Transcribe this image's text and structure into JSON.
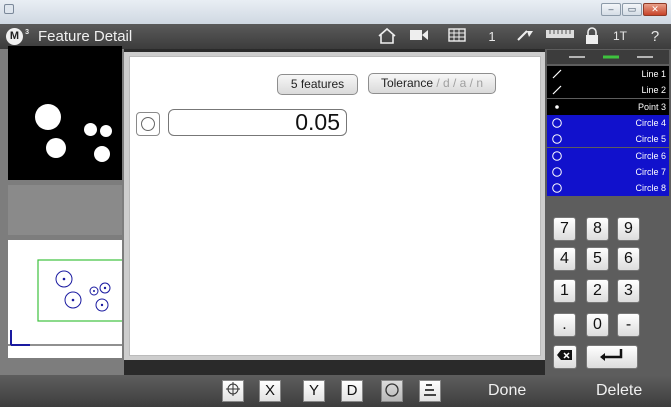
{
  "window": {
    "title": "Feature Detail",
    "logo_letter": "M",
    "logo_superscript": "3",
    "controls": [
      "–",
      "▭",
      "✕"
    ]
  },
  "toolbar": {
    "count": "1",
    "probe_label": "1T",
    "help_label": "?"
  },
  "main": {
    "features_button": "5 features",
    "tolerance_label": "Tolerance",
    "tolerance_options": " / d / a / n",
    "value": "0.05"
  },
  "feature_list": [
    {
      "icon": "line-icon",
      "label": "Line 1",
      "style": "black"
    },
    {
      "icon": "line-icon",
      "label": "Line 2",
      "style": "black"
    },
    {
      "icon": "point-icon",
      "label": "Point 3",
      "style": "black"
    },
    {
      "icon": "circle-icon",
      "label": "Circle 4",
      "style": "blue"
    },
    {
      "icon": "circle-icon",
      "label": "Circle 5",
      "style": "blue"
    },
    {
      "icon": "circle-icon",
      "label": "Circle 6",
      "style": "blue"
    },
    {
      "icon": "circle-icon",
      "label": "Circle 7",
      "style": "blue"
    },
    {
      "icon": "circle-icon",
      "label": "Circle 8",
      "style": "blue"
    }
  ],
  "keypad": {
    "keys": [
      "7",
      "8",
      "9",
      "4",
      "5",
      "6",
      "1",
      "2",
      "3",
      ".",
      "0",
      "-"
    ]
  },
  "bottom": {
    "x_label": "X",
    "y_label": "Y",
    "d_label": "D",
    "done_label": "Done",
    "delete_label": "Delete"
  },
  "colors": {
    "selection_blue": "#1111cc",
    "tolerance_muted": "#a0a0a0",
    "dro_green": "#3ec23e",
    "feature_marker": "#1a1aa0"
  }
}
